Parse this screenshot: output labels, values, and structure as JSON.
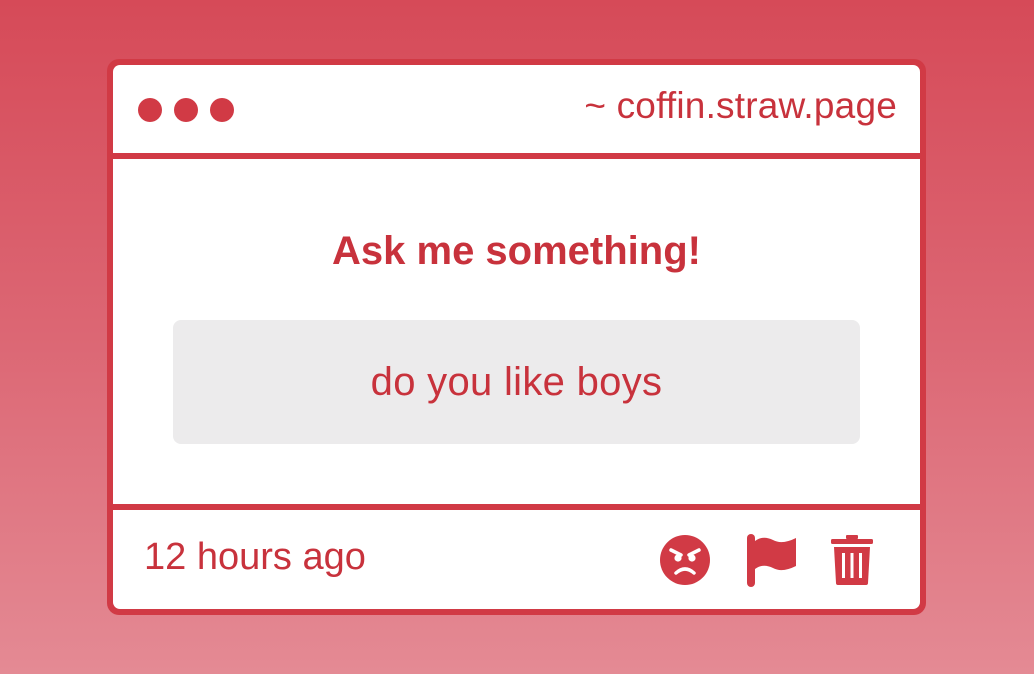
{
  "window": {
    "url": "~ coffin.straw.page"
  },
  "main": {
    "title": "Ask me something!",
    "question": "do you like boys"
  },
  "footer": {
    "timestamp": "12 hours ago",
    "icons": [
      "angry-face-icon",
      "flag-icon",
      "trash-icon"
    ]
  },
  "colors": {
    "accent": "#d13a45",
    "text": "#c8323c",
    "question_bg": "#ecebec"
  }
}
